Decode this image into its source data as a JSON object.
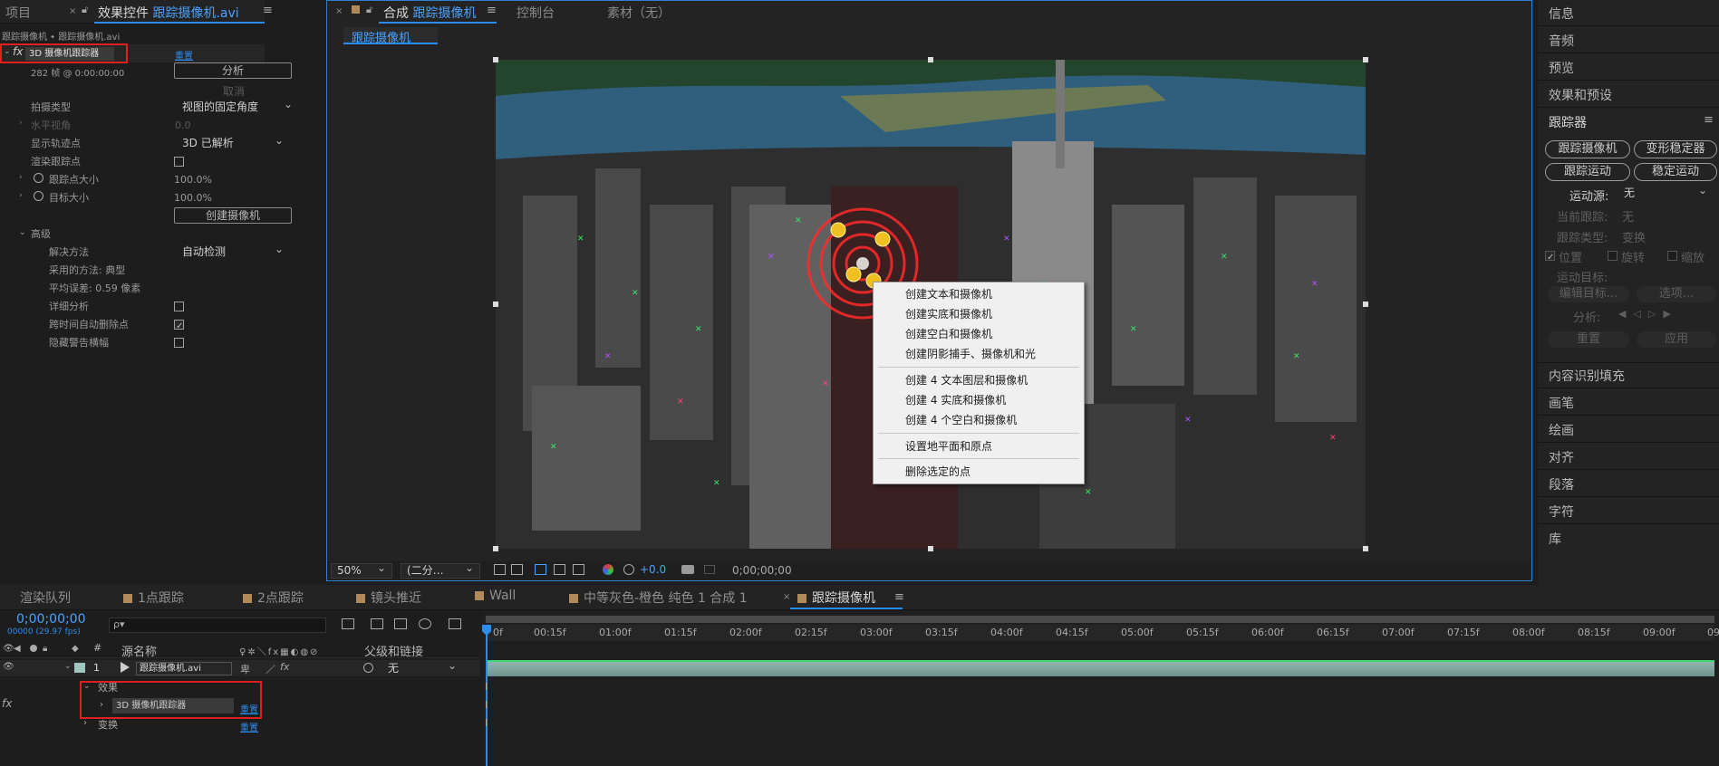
{
  "top_tabs": {
    "project": "项目",
    "effect_controls_prefix": "效果控件",
    "effect_controls_file": "跟踪摄像机.avi",
    "comp_prefix": "合成",
    "comp_name": "跟踪摄像机",
    "console": "控制台",
    "footage": "素材（无）",
    "comp_subtab": "跟踪摄像机"
  },
  "effect_controls": {
    "breadcrumb": "跟踪摄像机 • 跟踪摄像机.avi",
    "fx_label": "fx",
    "effect_name": "3D 摄像机跟踪器",
    "reset": "重置",
    "frames_info": "282 帧 @ 0:00:00:00",
    "analyze_btn": "分析",
    "cancel_btn": "取消",
    "shot_type_label": "拍摄类型",
    "shot_type_value": "视图的固定角度",
    "hfov_label": "水平视角",
    "hfov_value": "0.0",
    "show_tracks_label": "显示轨迹点",
    "show_tracks_value": "3D 已解析",
    "render_tracks_label": "渲染跟踪点",
    "track_size_label": "跟踪点大小",
    "track_size_value": "100.0%",
    "target_size_label": "目标大小",
    "target_size_value": "100.0%",
    "create_camera_btn": "创建摄像机",
    "advanced_label": "高级",
    "solve_method_label": "解决方法",
    "solve_method_value": "自动检测",
    "method_used": "采用的方法: 典型",
    "avg_error": "平均误差: 0.59 像素",
    "detailed_analysis_label": "详细分析",
    "auto_delete_label": "跨时间自动删除点",
    "hide_warning_label": "隐藏警告横幅"
  },
  "context_menu": {
    "items": [
      "创建文本和摄像机",
      "创建实底和摄像机",
      "创建空白和摄像机",
      "创建阴影捕手、摄像机和光"
    ],
    "items2": [
      "创建 4 文本图层和摄像机",
      "创建 4 实底和摄像机",
      "创建 4 个空白和摄像机"
    ],
    "items3": [
      "设置地平面和原点"
    ],
    "items4": [
      "删除选定的点"
    ]
  },
  "viewer_bar": {
    "zoom": "50%",
    "resolution": "(二分…",
    "exposure": "+0.0",
    "timecode": "0;00;00;00"
  },
  "right_panel": {
    "info": "信息",
    "audio": "音频",
    "preview": "预览",
    "effects_presets": "效果和预设",
    "tracker": "跟踪器",
    "track_camera": "跟踪摄像机",
    "warp_stabilizer": "变形稳定器",
    "track_motion": "跟踪运动",
    "stabilize_motion": "稳定运动",
    "motion_source_label": "运动源:",
    "motion_source_value": "无",
    "current_track_label": "当前跟踪:",
    "current_track_value": "无",
    "track_type_label": "跟踪类型:",
    "track_type_value": "变换",
    "position": "位置",
    "rotation": "旋转",
    "scale": "缩放",
    "motion_target": "运动目标:",
    "edit_target": "编辑目标...",
    "options": "选项...",
    "analyze": "分析:",
    "reset": "重置",
    "apply": "应用",
    "content_aware_fill": "内容识别填充",
    "brushes": "画笔",
    "paint": "绘画",
    "align": "对齐",
    "paragraph": "段落",
    "character": "字符",
    "library": "库"
  },
  "bottom_tabs": [
    "渲染队列",
    "1点跟踪",
    "2点跟踪",
    "镜头推近",
    "Wall",
    "中等灰色-橙色 纯色 1 合成 1",
    "跟踪摄像机"
  ],
  "timeline": {
    "timecode": "0;00;00;00",
    "fps": "00000 (29.97 fps)",
    "search_placeholder": "ρ▾",
    "col_source": "源名称",
    "col_parent": "父级和链接",
    "col_num": "#",
    "layer_num": "1",
    "layer_name": "跟踪摄像机.avi",
    "layer_parent": "无",
    "effects_label": "效果",
    "effect_item": "3D 摄像机跟踪器",
    "effect_reset": "重置",
    "transform_label": "变换",
    "transform_reset": "重置",
    "fx_icon": "fx",
    "ruler": [
      "0f",
      "00:15f",
      "01:00f",
      "01:15f",
      "02:00f",
      "02:15f",
      "03:00f",
      "03:15f",
      "04:00f",
      "04:15f",
      "05:00f",
      "05:15f",
      "06:00f",
      "06:15f",
      "07:00f",
      "07:15f",
      "08:00f",
      "08:15f",
      "09:00f",
      "09"
    ]
  },
  "colors": {
    "accent": "#2d8ceb",
    "highlight_box": "#e02020"
  }
}
